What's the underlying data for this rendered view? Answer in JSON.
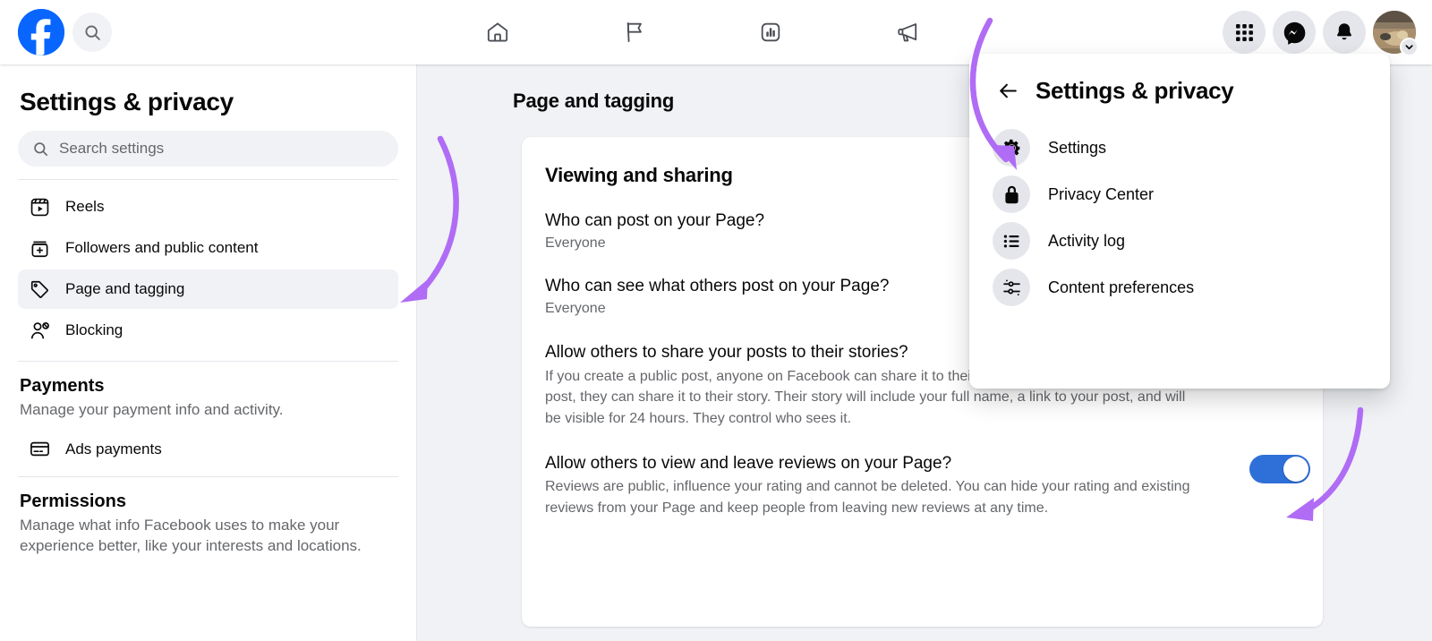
{
  "brand": {
    "accent": "#0866ff",
    "toggle_on": "#2f6fd8",
    "annotation": "#b06cf5"
  },
  "topbar": {
    "logo": "facebook-logo",
    "search_icon": "search-icon",
    "tabs": [
      {
        "icon": "home-icon",
        "name": "home"
      },
      {
        "icon": "flag-icon",
        "name": "pages"
      },
      {
        "icon": "insights-chart-icon",
        "name": "insights"
      },
      {
        "icon": "megaphone-icon",
        "name": "ads"
      }
    ],
    "actions": [
      {
        "icon": "grid-menu-icon",
        "name": "menu"
      },
      {
        "icon": "messenger-icon",
        "name": "messenger"
      },
      {
        "icon": "bell-icon",
        "name": "notifications"
      }
    ],
    "account": {
      "icon": "avatar",
      "chevron": "chevron-down-icon"
    }
  },
  "sidebar": {
    "title": "Settings & privacy",
    "search": {
      "placeholder": "Search settings",
      "icon": "search-icon",
      "value": ""
    },
    "items": [
      {
        "label": "Reels",
        "icon": "reels-icon",
        "active": false
      },
      {
        "label": "Followers and public content",
        "icon": "followers-icon",
        "active": false
      },
      {
        "label": "Page and tagging",
        "icon": "tag-icon",
        "active": true
      },
      {
        "label": "Blocking",
        "icon": "block-user-icon",
        "active": false
      }
    ],
    "sections": [
      {
        "title": "Payments",
        "desc": "Manage your payment info and activity.",
        "items": [
          {
            "label": "Ads payments",
            "icon": "credit-card-icon"
          }
        ]
      },
      {
        "title": "Permissions",
        "desc": "Manage what info Facebook uses to make your experience better, like your interests and locations.",
        "items": []
      }
    ]
  },
  "main": {
    "title": "Page and tagging",
    "card": {
      "heading": "Viewing and sharing",
      "rows": [
        {
          "question": "Who can post on your Page?",
          "value": "Everyone",
          "desc": "",
          "toggle": null
        },
        {
          "question": "Who can see what others post on your Page?",
          "value": "Everyone",
          "desc": "",
          "toggle": null
        },
        {
          "question": "Allow others to share your posts to their stories?",
          "value": "",
          "desc": "If you create a public post, anyone on Facebook can share it to their story. If you tag someone in any post, they can share it to their story. Their story will include your full name, a link to your post, and will be visible for 24 hours. They control who sees it.",
          "toggle": "on"
        },
        {
          "question": "Allow others to view and leave reviews on your Page?",
          "value": "",
          "desc": "Reviews are public, influence your rating and cannot be deleted. You can hide your rating and existing reviews from your Page and keep people from leaving new reviews at any time.",
          "toggle": "on"
        }
      ]
    }
  },
  "panel": {
    "back_icon": "arrow-left-icon",
    "title": "Settings & privacy",
    "items": [
      {
        "label": "Settings",
        "icon": "gear-icon"
      },
      {
        "label": "Privacy Center",
        "icon": "lock-icon"
      },
      {
        "label": "Activity log",
        "icon": "list-icon"
      },
      {
        "label": "Content preferences",
        "icon": "sliders-icon"
      }
    ]
  }
}
